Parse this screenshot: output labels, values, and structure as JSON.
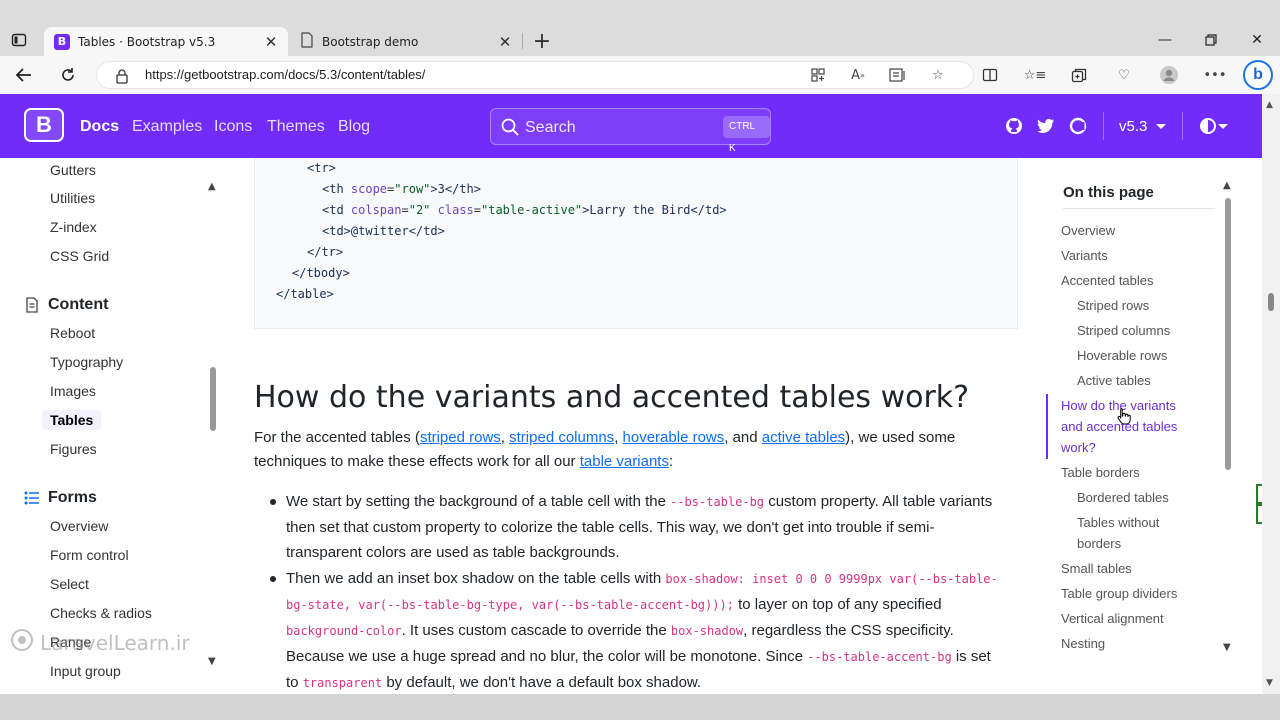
{
  "browser": {
    "tabs": [
      {
        "title": "Tables · Bootstrap v5.3",
        "favicon": "B"
      },
      {
        "title": "Bootstrap demo"
      }
    ],
    "url": "https://getbootstrap.com/docs/5.3/content/tables/",
    "bing_label": "b"
  },
  "navbar": {
    "brand": "B",
    "links": [
      "Docs",
      "Examples",
      "Icons",
      "Themes",
      "Blog"
    ],
    "search_placeholder": "Search",
    "search_shortcut": "CTRL K",
    "version": "v5.3"
  },
  "sidebar": {
    "items_top": [
      "Gutters",
      "Utilities",
      "Z-index",
      "CSS Grid"
    ],
    "content_group": "Content",
    "content_items": [
      "Reboot",
      "Typography",
      "Images",
      "Tables",
      "Figures"
    ],
    "forms_group": "Forms",
    "forms_items": [
      "Overview",
      "Form control",
      "Select",
      "Checks & radios",
      "Range",
      "Input group"
    ],
    "watermark": "LaravelLearn.ir"
  },
  "code": {
    "l1": "<tr>",
    "l2_open": "<th ",
    "l2_attr": "scope",
    "l2_eq": "=",
    "l2_val": "\"row\"",
    "l2_rest": ">3</th>",
    "l3_open": "<td ",
    "l3_attr1": "colspan",
    "l3_val1": "\"2\"",
    "l3_attr2": "class",
    "l3_val2": "\"table-active\"",
    "l3_rest": ">Larry the Bird</td>",
    "l4": "<td>@twitter</td>",
    "l5": "</tr>",
    "l6": "</tbody>",
    "l7": "</table>"
  },
  "main": {
    "heading": "How do the variants and accented tables work?",
    "intro_before": "For the accented tables (",
    "link_striped_rows": "striped rows",
    "comma1": ", ",
    "link_striped_columns": "striped columns",
    "comma2": ", ",
    "link_hoverable_rows": "hoverable rows",
    "and_text": ", and ",
    "link_active_tables": "active tables",
    "intro_after": "), we used some",
    "intro_line2_before": "techniques to make these effects work for all our ",
    "link_table_variants": "table variants",
    "intro_line2_after": ":",
    "bullet1_a": "We start by setting the background of a table cell with the ",
    "bullet1_code": "--bs-table-bg",
    "bullet1_b": " custom property. All table variants then set that custom property to colorize the table cells. This way, we don't get into trouble if semi-transparent colors are used as table backgrounds.",
    "bullet2_a": "Then we add an inset box shadow on the table cells with ",
    "bullet2_code1": "box-shadow: inset 0 0 0 9999px var(--bs-table-bg-state, var(--bs-table-bg-type, var(--bs-table-accent-bg)));",
    "bullet2_b": " to layer on top of any specified ",
    "bullet2_code2": "background-color",
    "bullet2_c": ". It uses custom cascade to override the ",
    "bullet2_code3": "box-shadow",
    "bullet2_d": ", regardless the CSS specificity. Because we use a huge spread and no blur, the color will be monotone. Since ",
    "bullet2_code4": "--bs-table-accent-bg",
    "bullet2_e": " is set to ",
    "bullet2_code5": "transparent",
    "bullet2_f": " by default, we don't have a default box shadow."
  },
  "toc": {
    "title": "On this page",
    "links": [
      "Overview",
      "Variants",
      "Accented tables",
      "Striped rows",
      "Striped columns",
      "Hoverable rows",
      "Active tables",
      "How do the variants and accented tables work?",
      "Table borders",
      "Bordered tables",
      "Tables without borders",
      "Small tables",
      "Table group dividers",
      "Vertical alignment",
      "Nesting"
    ]
  },
  "colors": {
    "brand": "#712cf9",
    "link": "#0d6efd",
    "code_pink": "#d63384"
  }
}
